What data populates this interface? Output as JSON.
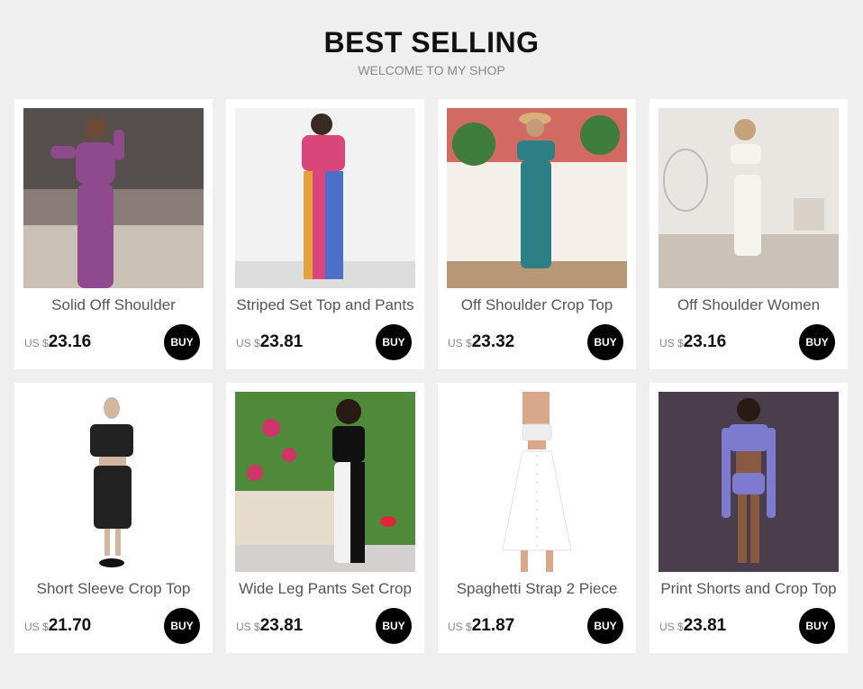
{
  "header": {
    "title": "BEST SELLING",
    "subtitle": "WELCOME TO MY SHOP"
  },
  "currency_label": "US $",
  "buy_label": "BUY",
  "products": [
    {
      "name": "Solid Off Shoulder",
      "price": "23.16",
      "colors": {
        "bg": "#8a7d78",
        "outfit": "#8e4a8c"
      }
    },
    {
      "name": "Striped Set Top and Pants",
      "price": "23.81",
      "colors": {
        "bg": "#f2f2f2",
        "outfit": "#d9467a"
      }
    },
    {
      "name": "Off Shoulder Crop Top",
      "price": "23.32",
      "colors": {
        "bg": "#d06a62",
        "outfit": "#2d7f86"
      }
    },
    {
      "name": "Off Shoulder Women",
      "price": "23.16",
      "colors": {
        "bg": "#e9e6e1",
        "outfit": "#f6f2ec"
      }
    },
    {
      "name": "Short Sleeve Crop Top",
      "price": "21.70",
      "colors": {
        "bg": "#ffffff",
        "outfit": "#222222"
      }
    },
    {
      "name": "Wide Leg Pants Set Crop",
      "price": "23.81",
      "colors": {
        "bg": "#4f8a3a",
        "outfit": "#111111"
      }
    },
    {
      "name": "Spaghetti Strap 2 Piece",
      "price": "21.87",
      "colors": {
        "bg": "#ffffff",
        "outfit": "#f4f4f4"
      }
    },
    {
      "name": "Print Shorts and Crop Top",
      "price": "23.81",
      "colors": {
        "bg": "#4a3d4c",
        "outfit": "#7d7bd0"
      }
    }
  ]
}
